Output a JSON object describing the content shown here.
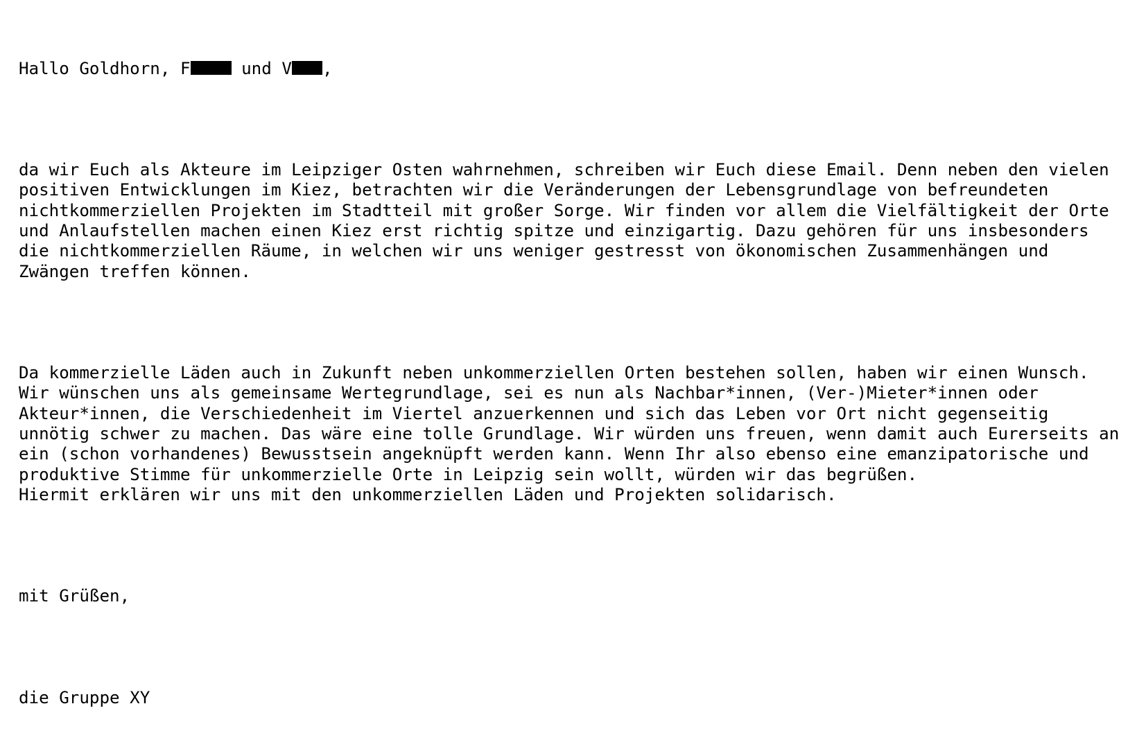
{
  "greeting": {
    "prefix": "Hallo Goldhorn, F",
    "middle": " und V",
    "suffix": ","
  },
  "paragraphs": [
    {
      "lines": [
        "da wir Euch als Akteure im Leipziger Osten wahrnehmen, schreiben wir Euch diese Email. Denn neben den vielen",
        "positiven Entwicklungen im Kiez, betrachten wir die Veränderungen der Lebensgrundlage von befreundeten",
        "nichtkommerziellen Projekten im Stadtteil mit großer Sorge. Wir finden vor allem die Vielfältigkeit der Orte",
        "und Anlaufstellen machen einen Kiez erst richtig spitze und einzigartig. Dazu gehören für uns insbesonders",
        "die nichtkommerziellen Räume, in welchen wir uns weniger gestresst von ökonomischen Zusammenhängen und",
        "Zwängen treffen können."
      ]
    },
    {
      "lines": [
        "Da kommerzielle Läden auch in Zukunft neben unkommerziellen Orten bestehen sollen, haben wir einen Wunsch.",
        "Wir wünschen uns als gemeinsame Wertegrundlage, sei es nun als Nachbar*innen, (Ver-)Mieter*innen oder",
        "Akteur*innen, die Verschiedenheit im Viertel anzuerkennen und sich das Leben vor Ort nicht gegenseitig",
        "unnötig schwer zu machen. Das wäre eine tolle Grundlage. Wir würden uns freuen, wenn damit auch Eurerseits an",
        "ein (schon vorhandenes) Bewusstsein angeknüpft werden kann. Wenn Ihr also ebenso eine emanzipatorische und",
        "produktive Stimme für unkommerzielle Orte in Leipzig sein wollt, würden wir das begrüßen.",
        "Hiermit erklären wir uns mit den unkommerziellen Läden und Projekten solidarisch."
      ]
    }
  ],
  "closing": "mit Grüßen,",
  "signature": "die Gruppe XY"
}
